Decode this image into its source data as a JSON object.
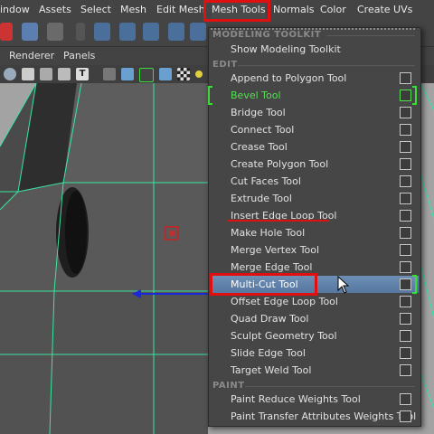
{
  "menubar": {
    "items": [
      "indow",
      "Assets",
      "Select",
      "Mesh",
      "Edit Mesh",
      "Mesh Tools",
      "Normals",
      "Color",
      "Create UVs"
    ]
  },
  "panel_menu": {
    "renderer": "Renderer",
    "panels": "Panels"
  },
  "dropdown": {
    "sections": {
      "modeling_toolkit": "MODELING TOOLKIT",
      "edit": "EDIT",
      "paint": "PAINT"
    },
    "show_modeling_toolkit": "Show Modeling Toolkit",
    "edit_items": [
      "Append to Polygon Tool",
      "Bevel Tool",
      "Bridge Tool",
      "Connect Tool",
      "Crease Tool",
      "Create Polygon Tool",
      "Cut Faces Tool",
      "Extrude Tool",
      "Insert Edge Loop Tool",
      "Make Hole Tool",
      "Merge Vertex Tool",
      "Merge Edge Tool",
      "Multi-Cut Tool",
      "Offset Edge Loop Tool",
      "Quad Draw Tool",
      "Sculpt Geometry Tool",
      "Slide Edge Tool",
      "Target Weld Tool"
    ],
    "paint_items": [
      "Paint Reduce Weights Tool",
      "Paint Transfer Attributes Weights Tool"
    ]
  },
  "colors": {
    "highlight": "#5f82ab",
    "active_green": "#52e052",
    "annotation_red": "#e01010",
    "wire": "#39e6a0"
  }
}
